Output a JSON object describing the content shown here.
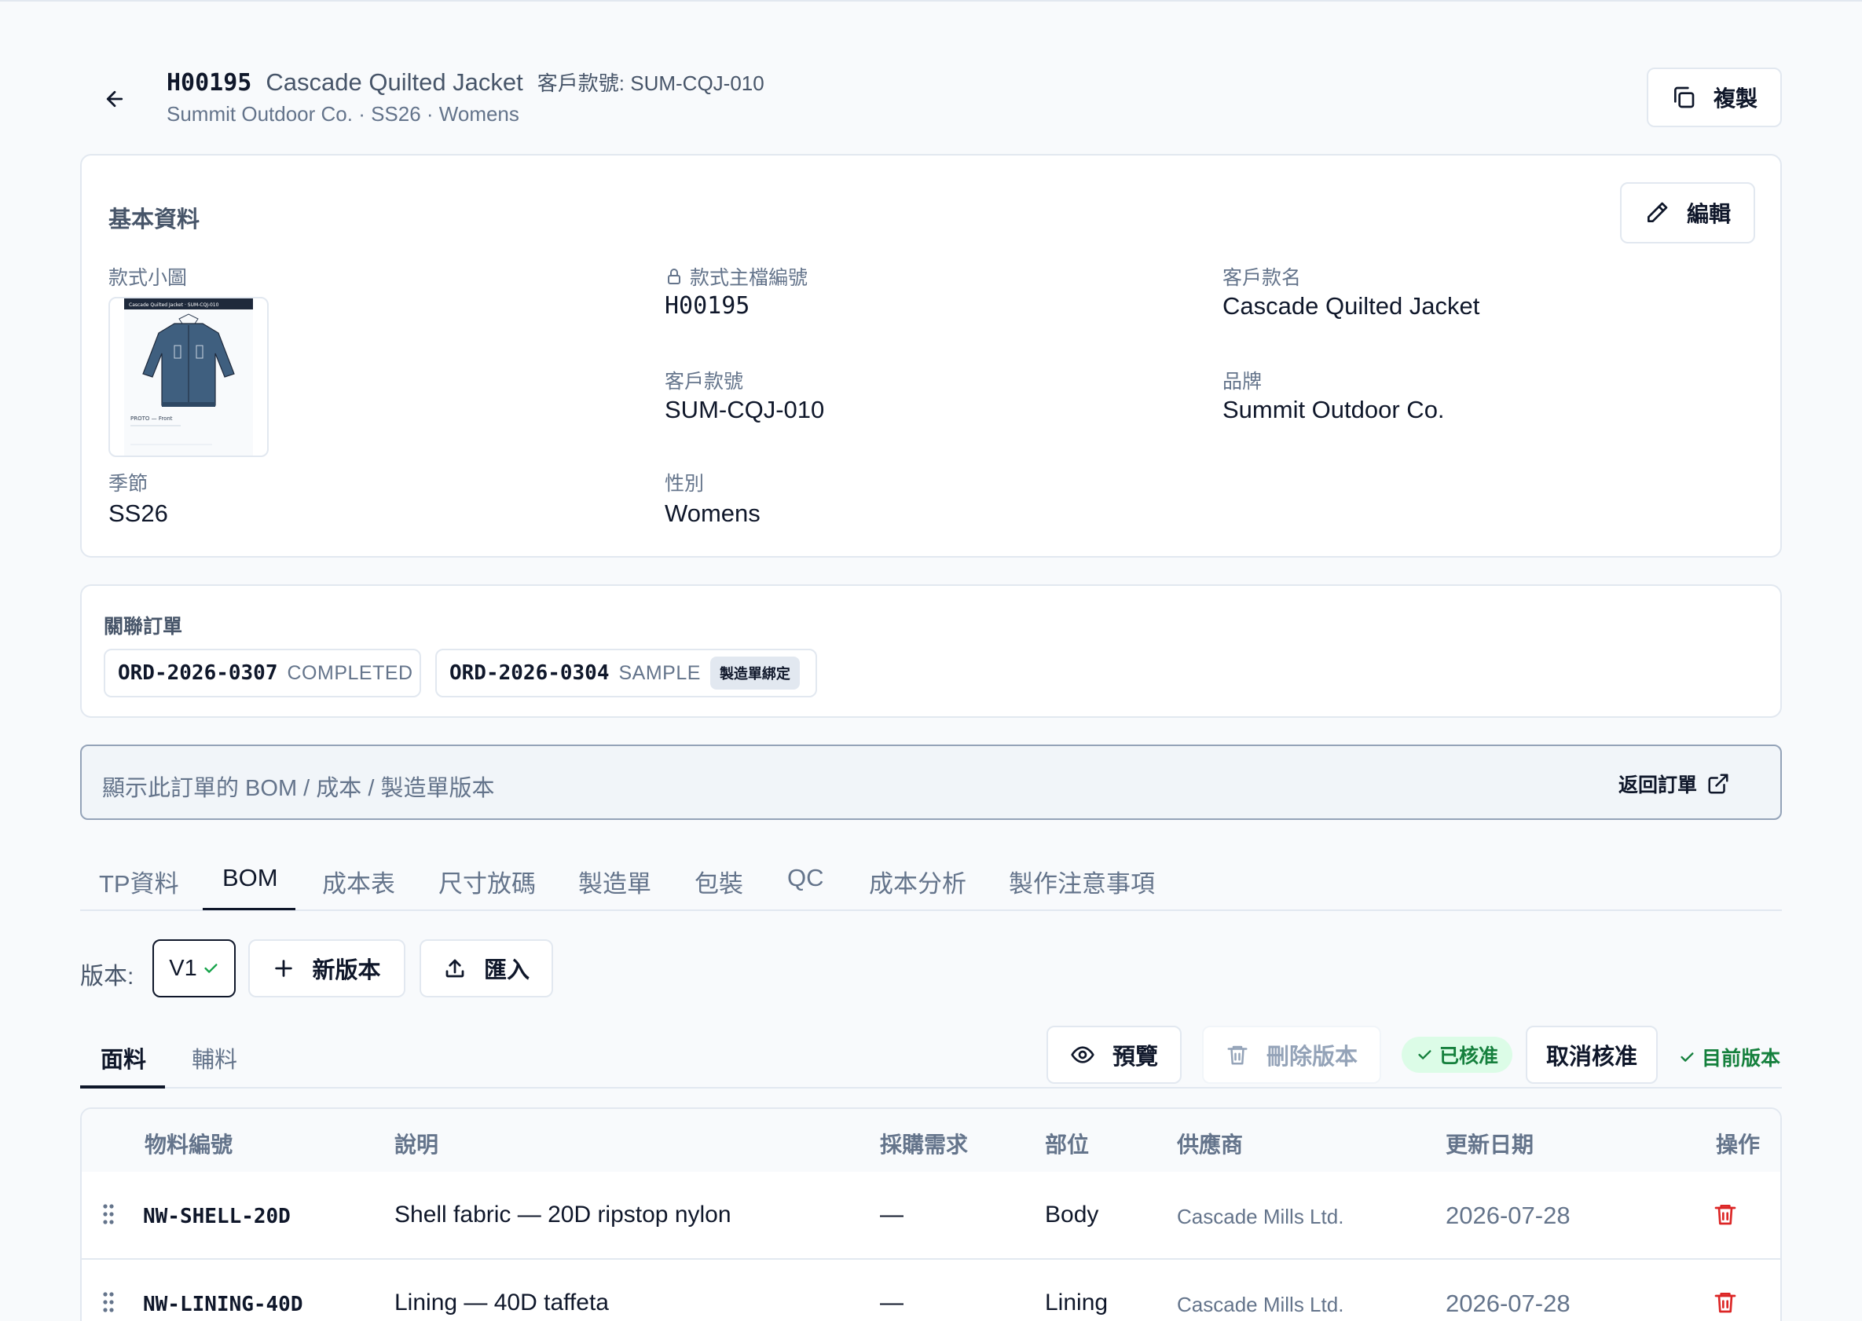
{
  "header": {
    "code": "H00195",
    "name": "Cascade Quilted Jacket",
    "customer_style": "客戶款號: SUM-CQJ-010",
    "subtitle": "Summit Outdoor Co. · SS26 · Womens",
    "copy_label": "複製"
  },
  "basic": {
    "title": "基本資料",
    "edit_label": "編輯",
    "thumb_label": "款式小圖",
    "thumb": {
      "header_text": "Cascade Quilted Jacket · SUM-CQJ-010",
      "caption": "PROTO — Front",
      "garment_color": "#3f5f7f"
    },
    "style_code_label": "款式主檔編號",
    "style_code": "H00195",
    "customer_name_label": "客戶款名",
    "customer_name": "Cascade Quilted Jacket",
    "customer_no_label": "客戶款號",
    "customer_no": "SUM-CQJ-010",
    "brand_label": "品牌",
    "brand": "Summit Outdoor Co.",
    "season_label": "季節",
    "season": "SS26",
    "gender_label": "性別",
    "gender": "Womens"
  },
  "orders": {
    "title": "關聯訂單",
    "items": [
      {
        "code": "ORD-2026-0307",
        "status": "COMPLETED",
        "badge": ""
      },
      {
        "code": "ORD-2026-0304",
        "status": "SAMPLE",
        "badge": "製造單綁定"
      }
    ]
  },
  "banner": {
    "text": "顯示此訂單的 BOM / 成本 / 製造單版本",
    "link": "返回訂單"
  },
  "tabs": [
    "TP資料",
    "BOM",
    "成本表",
    "尺寸放碼",
    "製造單",
    "包裝",
    "QC",
    "成本分析",
    "製作注意事項"
  ],
  "version": {
    "label": "版本:",
    "current": "V1",
    "new_label": "新版本",
    "import_label": "匯入"
  },
  "subtabs": [
    "面料",
    "輔料"
  ],
  "toolbar": {
    "preview": "預覽",
    "delete_version": "刪除版本",
    "approved": "已核准",
    "cancel_approval": "取消核准",
    "current_version": "目前版本"
  },
  "table": {
    "headers": [
      "物料編號",
      "說明",
      "採購需求",
      "部位",
      "供應商",
      "更新日期",
      "操作"
    ],
    "rows": [
      {
        "code": "NW-SHELL-20D",
        "desc": "Shell fabric — 20D ripstop nylon",
        "purchase": "—",
        "part": "Body",
        "supplier": "Cascade Mills Ltd.",
        "date": "2026-07-28"
      },
      {
        "code": "NW-LINING-40D",
        "desc": "Lining — 40D taffeta",
        "purchase": "—",
        "part": "Lining",
        "supplier": "Cascade Mills Ltd.",
        "date": "2026-07-28"
      }
    ]
  },
  "colors": {
    "accent": "#0f172a",
    "success": "#15803d",
    "danger": "#dc2626",
    "muted": "#64748b"
  }
}
